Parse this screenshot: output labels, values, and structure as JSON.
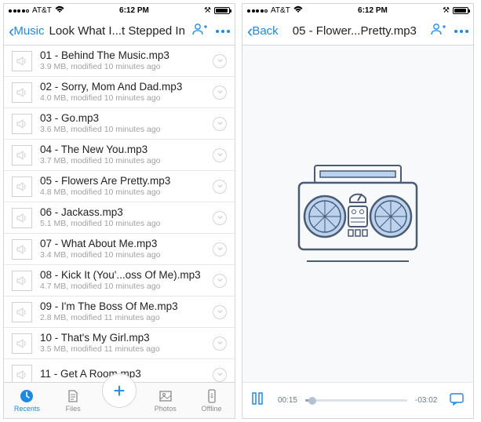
{
  "status": {
    "carrier": "AT&T",
    "time": "6:12 PM"
  },
  "left": {
    "back_label": "Music",
    "title": "Look What I...t Stepped In",
    "tracks": [
      {
        "name": "01 - Behind The Music.mp3",
        "sub": "3.9 MB, modified 10 minutes ago"
      },
      {
        "name": "02 - Sorry, Mom And Dad.mp3",
        "sub": "4.0 MB, modified 10 minutes ago"
      },
      {
        "name": "03 - Go.mp3",
        "sub": "3.6 MB, modified 10 minutes ago"
      },
      {
        "name": "04 - The New You.mp3",
        "sub": "3.7 MB, modified 10 minutes ago"
      },
      {
        "name": "05 - Flowers Are Pretty.mp3",
        "sub": "4.8 MB, modified 10 minutes ago"
      },
      {
        "name": "06 - Jackass.mp3",
        "sub": "5.1 MB, modified 10 minutes ago"
      },
      {
        "name": "07 - What About Me.mp3",
        "sub": "3.4 MB, modified 10 minutes ago"
      },
      {
        "name": "08 - Kick It (You'...oss Of Me).mp3",
        "sub": "4.7 MB, modified 10 minutes ago"
      },
      {
        "name": "09 - I'm The Boss Of Me.mp3",
        "sub": "2.8 MB, modified 11 minutes ago"
      },
      {
        "name": "10 - That's My Girl.mp3",
        "sub": "3.5 MB, modified 11 minutes ago"
      },
      {
        "name": "11 - Get A Room.mp3",
        "sub": ""
      }
    ],
    "tabs": {
      "recents": "Recents",
      "files": "Files",
      "photos": "Photos",
      "offline": "Offline"
    }
  },
  "right": {
    "back_label": "Back",
    "title": "05 - Flower...Pretty.mp3",
    "elapsed": "00:15",
    "remaining": "-03:02"
  }
}
